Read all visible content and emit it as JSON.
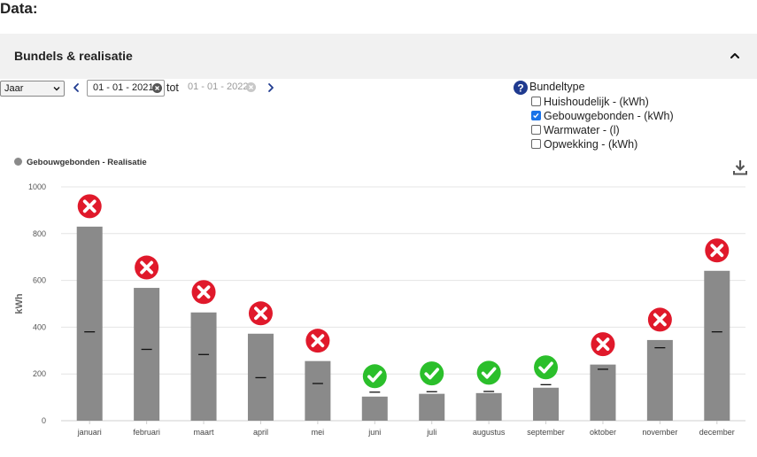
{
  "page": {
    "heading": "Data:"
  },
  "panel": {
    "title": "Bundels & realisatie"
  },
  "toolbar": {
    "period": "Jaar",
    "date_from": "01 - 01 - 2021",
    "tot_label": "tot",
    "date_to": "01 - 01 - 2022"
  },
  "bundeltype": {
    "title": "Bundeltype",
    "options": [
      {
        "label": "Huishoudelijk - (kWh)",
        "checked": false
      },
      {
        "label": "Gebouwgebonden - (kWh)",
        "checked": true
      },
      {
        "label": "Warmwater - (l)",
        "checked": false
      },
      {
        "label": "Opwekking - (kWh)",
        "checked": false
      }
    ]
  },
  "colors": {
    "bar": "#8a8a8a",
    "fail": "#e0192b",
    "ok": "#2bbf2b",
    "grid": "#e4e4e4",
    "accent": "#1a73e8"
  },
  "icons": [
    "chevron-up-icon",
    "chevron-left-icon",
    "chevron-right-icon",
    "clear-icon",
    "help-icon",
    "download-icon",
    "fail-icon",
    "ok-icon"
  ],
  "chart_data": {
    "type": "bar",
    "legend": "Gebouwgebonden - Realisatie",
    "legend_position": "top-left",
    "ylabel": "kWh",
    "ylim": [
      0,
      1000
    ],
    "yticks": [
      0,
      200,
      400,
      600,
      800,
      1000
    ],
    "grid": true,
    "categories": [
      "januari",
      "februari",
      "maart",
      "april",
      "mei",
      "juni",
      "juli",
      "augustus",
      "september",
      "oktober",
      "november",
      "december"
    ],
    "series": [
      {
        "name": "Gebouwgebonden - Realisatie",
        "values": [
          830,
          568,
          463,
          372,
          255,
          103,
          115,
          118,
          141,
          240,
          345,
          641
        ]
      }
    ],
    "targets": [
      380,
      305,
      283,
      184,
      159,
      122,
      124,
      125,
      154,
      220,
      312,
      380
    ],
    "status": [
      "fail",
      "fail",
      "fail",
      "fail",
      "fail",
      "ok",
      "ok",
      "ok",
      "ok",
      "fail",
      "fail",
      "fail"
    ]
  }
}
